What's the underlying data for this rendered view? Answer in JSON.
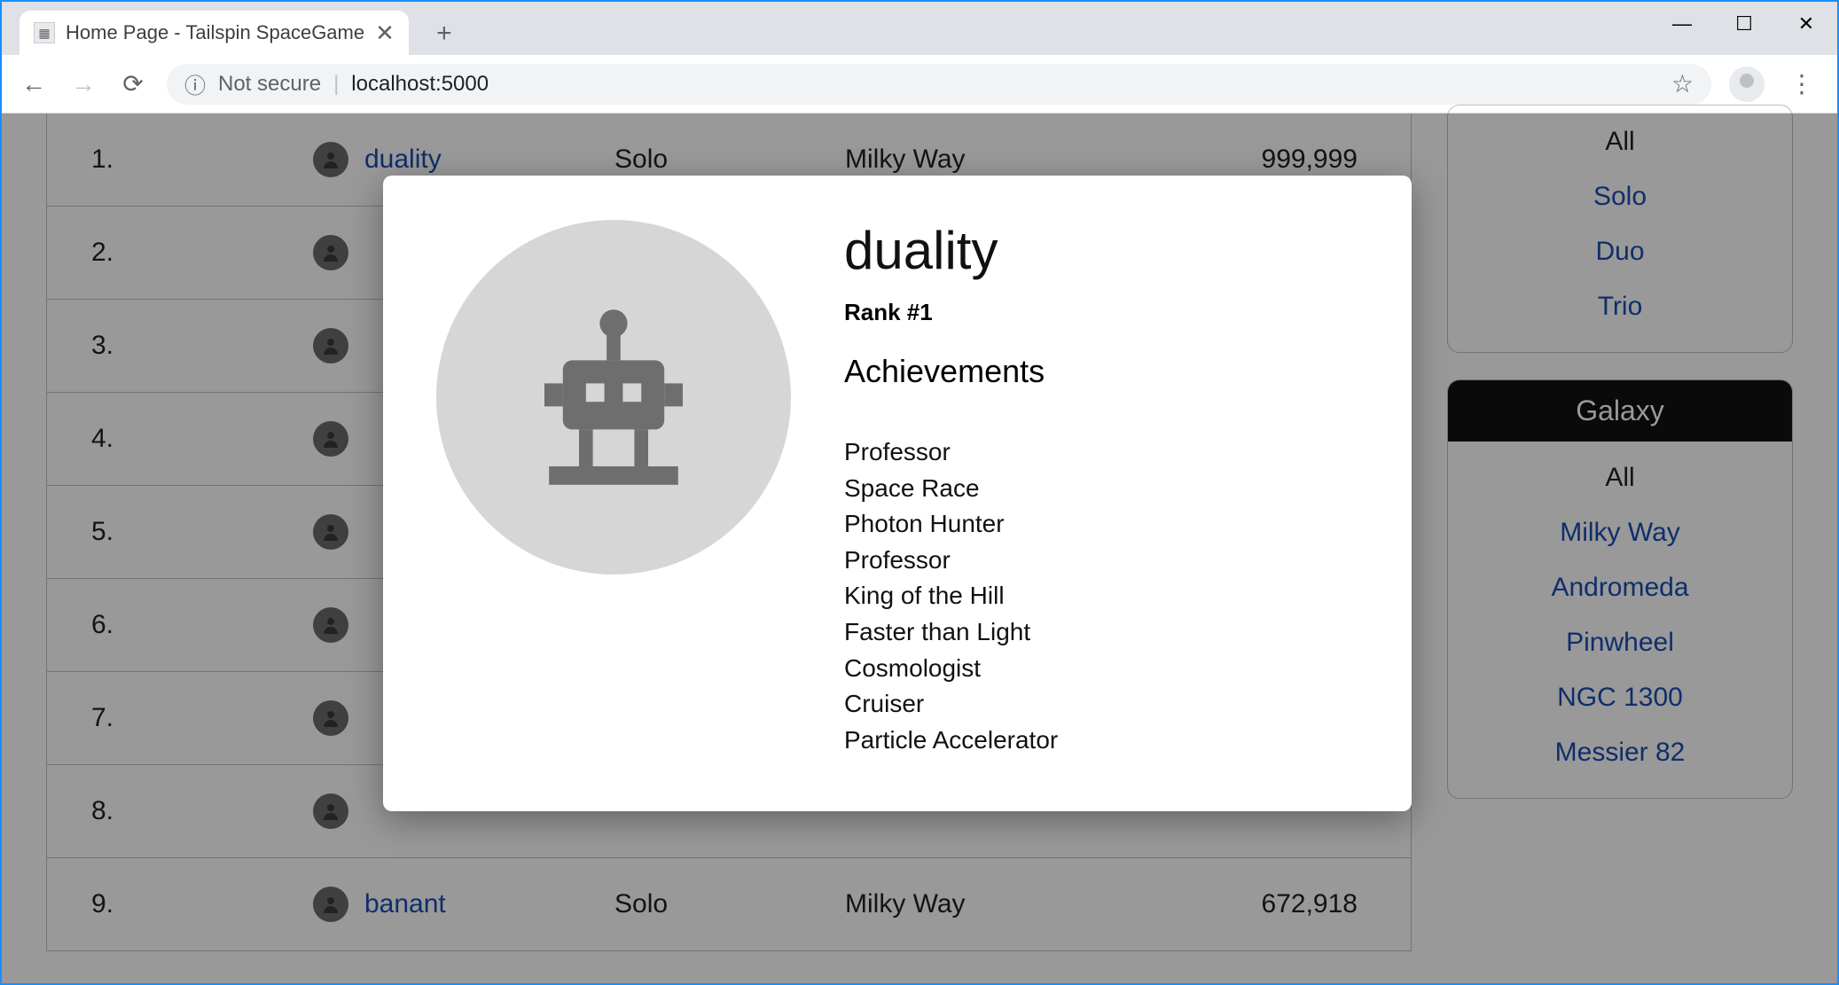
{
  "browser": {
    "tab_title": "Home Page - Tailspin SpaceGame",
    "not_secure_label": "Not secure",
    "url": "localhost:5000"
  },
  "leaderboard": {
    "rows": [
      {
        "rank": "1.",
        "name": "duality",
        "mode": "Solo",
        "galaxy": "Milky Way",
        "score": "999,999"
      },
      {
        "rank": "2.",
        "name": "",
        "mode": "",
        "galaxy": "",
        "score": ""
      },
      {
        "rank": "3.",
        "name": "",
        "mode": "",
        "galaxy": "",
        "score": ""
      },
      {
        "rank": "4.",
        "name": "",
        "mode": "",
        "galaxy": "",
        "score": ""
      },
      {
        "rank": "5.",
        "name": "",
        "mode": "",
        "galaxy": "",
        "score": ""
      },
      {
        "rank": "6.",
        "name": "",
        "mode": "",
        "galaxy": "",
        "score": ""
      },
      {
        "rank": "7.",
        "name": "",
        "mode": "",
        "galaxy": "",
        "score": ""
      },
      {
        "rank": "8.",
        "name": "",
        "mode": "",
        "galaxy": "",
        "score": ""
      },
      {
        "rank": "9.",
        "name": "banant",
        "mode": "Solo",
        "galaxy": "Milky Way",
        "score": "672,918"
      }
    ]
  },
  "sidebar": {
    "mode_panel": {
      "items": [
        "All",
        "Solo",
        "Duo",
        "Trio"
      ],
      "current": "All"
    },
    "galaxy_panel": {
      "header": "Galaxy",
      "items": [
        "All",
        "Milky Way",
        "Andromeda",
        "Pinwheel",
        "NGC 1300",
        "Messier 82"
      ],
      "current": "All"
    }
  },
  "modal": {
    "name": "duality",
    "rank_label": "Rank #1",
    "achievements_title": "Achievements",
    "achievements": [
      "Professor",
      "Space Race",
      "Photon Hunter",
      "Professor",
      "King of the Hill",
      "Faster than Light",
      "Cosmologist",
      "Cruiser",
      "Particle Accelerator"
    ]
  }
}
